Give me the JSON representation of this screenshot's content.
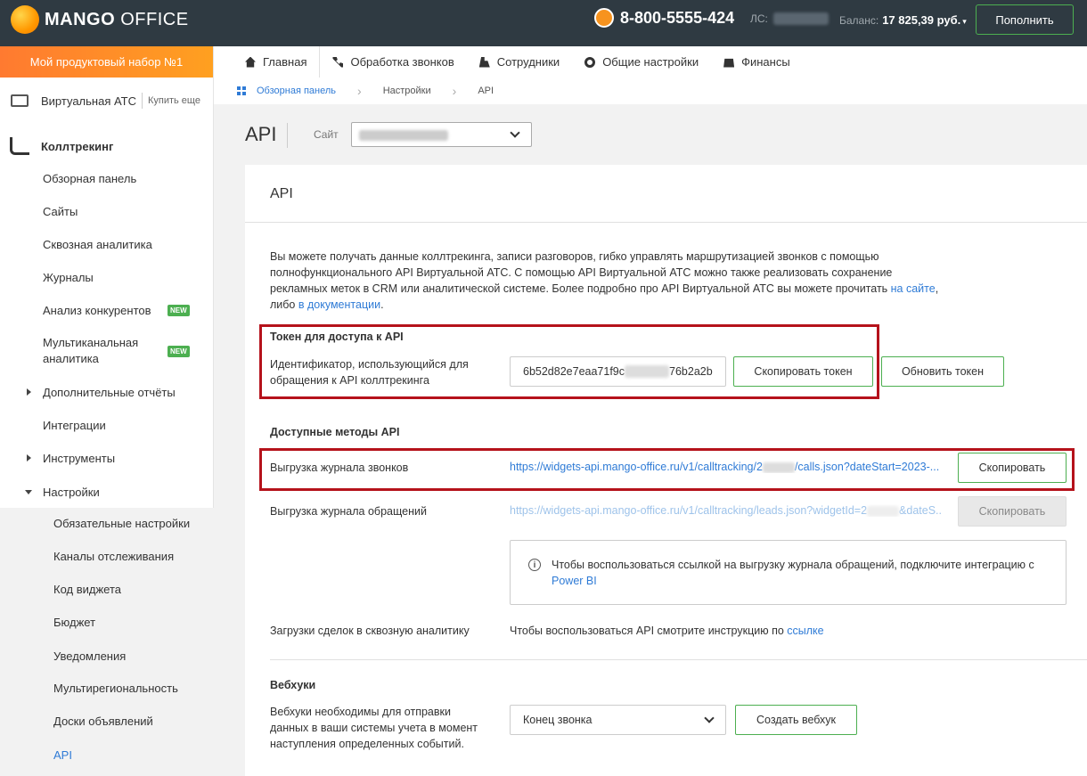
{
  "brand": {
    "logo_bold": "MANGO",
    "logo_light": " OFFICE"
  },
  "header": {
    "phone": "8-800-5555-424",
    "ls_label": "ЛС:",
    "balance_label": "Баланс:",
    "balance_value": "17 825,39 руб.",
    "topup_label": "Пополнить"
  },
  "sidebar": {
    "product_set": "Мой продуктовый набор №1",
    "vats_label": "Виртуальная АТС",
    "vats_buy": "Купить еще",
    "section_title": "Коллтрекинг",
    "items": [
      {
        "label": "Обзорная панель"
      },
      {
        "label": "Сайты"
      },
      {
        "label": "Сквозная аналитика"
      },
      {
        "label": "Журналы"
      },
      {
        "label": "Анализ конкурентов",
        "badge": "NEW"
      },
      {
        "label": "Мультиканальная аналитика",
        "badge": "NEW"
      },
      {
        "label": "Дополнительные отчёты"
      },
      {
        "label": "Интеграции"
      },
      {
        "label": "Инструменты"
      },
      {
        "label": "Настройки"
      }
    ],
    "settings_items": [
      {
        "label": "Обязательные настройки"
      },
      {
        "label": "Каналы отслеживания"
      },
      {
        "label": "Код виджета"
      },
      {
        "label": "Бюджет"
      },
      {
        "label": "Уведомления"
      },
      {
        "label": "Мультирегиональность"
      },
      {
        "label": "Доски объявлений"
      },
      {
        "label": "API"
      }
    ]
  },
  "topnav": {
    "home": "Главная",
    "calls": "Обработка звонков",
    "staff": "Сотрудники",
    "settings": "Общие настройки",
    "finance": "Финансы"
  },
  "breadcrumb": {
    "dashboard": "Обзорная панель",
    "settings": "Настройки",
    "current": "API"
  },
  "page": {
    "title": "API",
    "site_label": "Сайт"
  },
  "card": {
    "title": "API",
    "description_1": "Вы можете получать данные коллтрекинга, записи разговоров, гибко управлять маршрутизацией звонков с помощью полнофункционального API Виртуальной АТС. С помощью API Виртуальной АТС можно также реализовать сохранение рекламных меток в CRM или аналитической системе. Более подробно про API Виртуальной АТС вы можете прочитать ",
    "description_link1": "на сайте",
    "description_2": ", либо ",
    "description_link2": "в документации",
    "description_3": ".",
    "token": {
      "title": "Токен для доступа к API",
      "label": "Идентификатор, использующийся для обращения к API коллтрекинга",
      "value_start": "6b52d82e7eaa71f9c",
      "value_end": "76b2a2b",
      "copy_label": "Скопировать токен",
      "refresh_label": "Обновить токен"
    },
    "methods": {
      "title": "Доступные методы API",
      "calls_label": "Выгрузка журнала звонков",
      "calls_url_start": "https://widgets-api.mango-office.ru/v1/calltracking/2",
      "calls_url_end": "/calls.json?dateStart=2023-...",
      "calls_copy": "Скопировать",
      "leads_label": "Выгрузка журнала обращений",
      "leads_url_start": "https://widgets-api.mango-office.ru/v1/calltracking/leads.json?widgetId=2",
      "leads_url_end": "&dateS...",
      "leads_copy": "Скопировать",
      "info_text": "Чтобы воспользоваться ссылкой на выгрузку журнала обращений, подключите интеграцию с ",
      "info_link": "Power BI",
      "deals_label": "Загрузки сделок в сквозную аналитику",
      "deals_text": "Чтобы воспользоваться API смотрите инструкцию по ",
      "deals_link": "ссылке"
    },
    "webhooks": {
      "title": "Вебхуки",
      "label": "Вебхуки необходимы для отправки данных в ваши системы учета в момент наступления определенных событий.",
      "select_value": "Конец звонка",
      "create_label": "Создать вебхук"
    }
  }
}
